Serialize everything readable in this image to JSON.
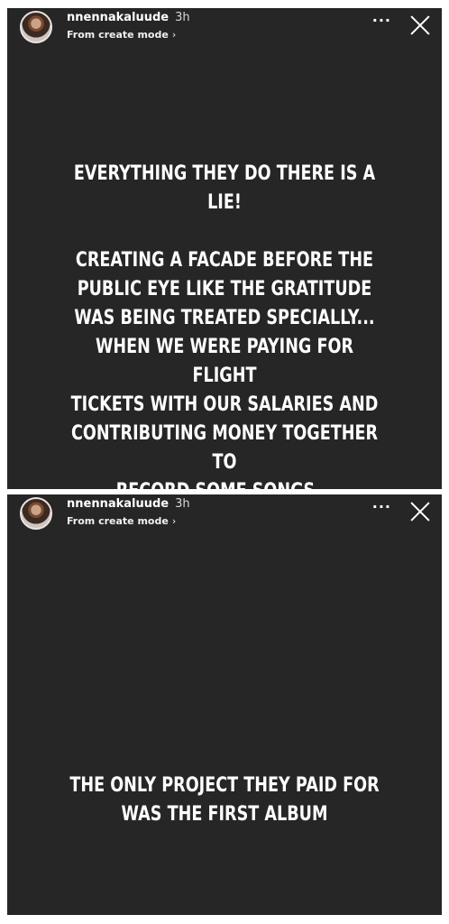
{
  "stories": [
    {
      "username": "nnennakaluude",
      "time": "3h",
      "subtitle": "From create mode",
      "chevron": "›",
      "more_label": "···",
      "paragraphs": [
        "EVERYTHING THEY DO THERE IS A\nLIE!",
        "CREATING A FACADE BEFORE THE\nPUBLIC EYE LIKE THE GRATITUDE\nWAS BEING TREATED SPECIALLY...\nWHEN WE WERE PAYING FOR FLIGHT\nTICKETS WITH OUR SALARIES AND\nCONTRIBUTING MONEY TOGETHER TO\nRECORD SOME SONGS..."
      ]
    },
    {
      "username": "nnennakaluude",
      "time": "3h",
      "subtitle": "From create mode",
      "chevron": "›",
      "more_label": "···",
      "paragraphs": [
        "THE ONLY PROJECT THEY PAID FOR\nWAS THE FIRST ALBUM"
      ]
    }
  ],
  "colors": {
    "story_background": "#262626",
    "text": "#ffffff",
    "page_background": "#ffffff"
  },
  "icons": {
    "avatar": "profile-photo",
    "more": "more-options-icon",
    "close": "close-icon"
  }
}
